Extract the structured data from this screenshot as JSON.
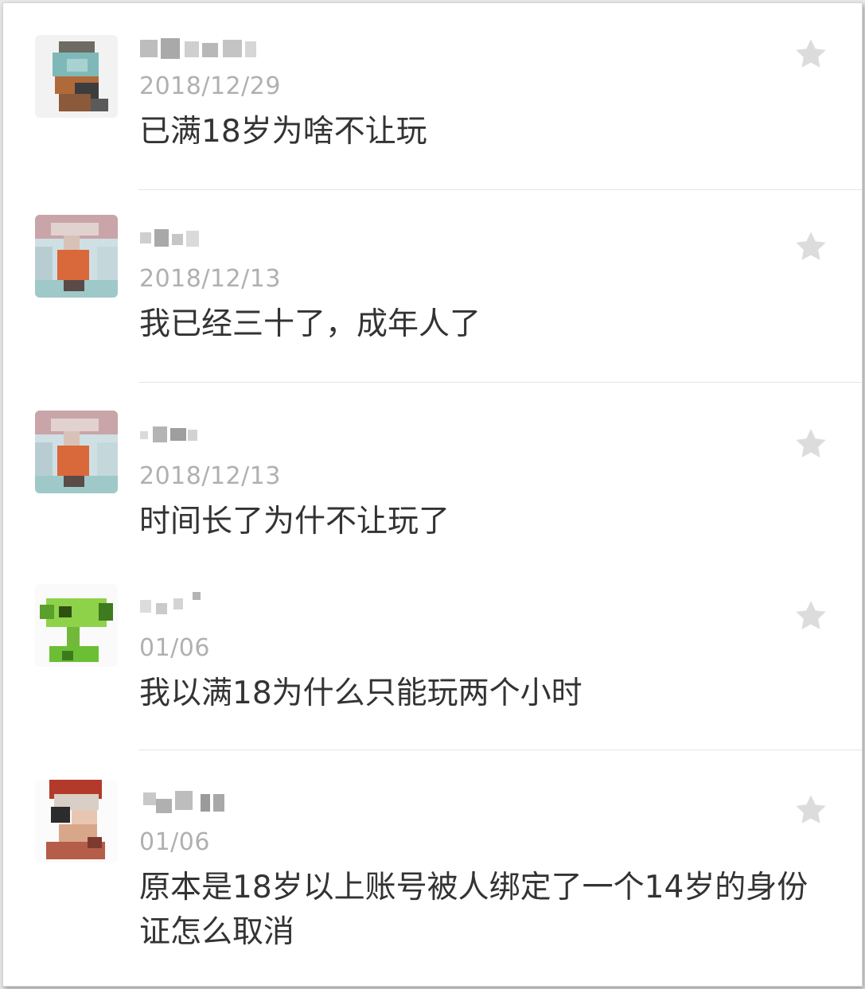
{
  "comments": [
    {
      "username": "",
      "date": "2018/12/29",
      "text": "已满18岁为啥不让玩"
    },
    {
      "username": "",
      "date": "2018/12/13",
      "text": "我已经三十了，成年人了"
    },
    {
      "username": "",
      "date": "2018/12/13",
      "text": "时间长了为什不让玩了"
    },
    {
      "username": "",
      "date": "01/06",
      "text": "我以满18为什么只能玩两个小时"
    },
    {
      "username": "",
      "date": "01/06",
      "text": "原本是18岁以上账号被人绑定了一个14岁的身份证怎么取消"
    }
  ],
  "icons": {
    "avatar": "user-avatar-icon",
    "favorite": "star-icon"
  },
  "colors": {
    "star": "#dcdcdc",
    "date": "#b0b0b0",
    "text": "#333333"
  }
}
